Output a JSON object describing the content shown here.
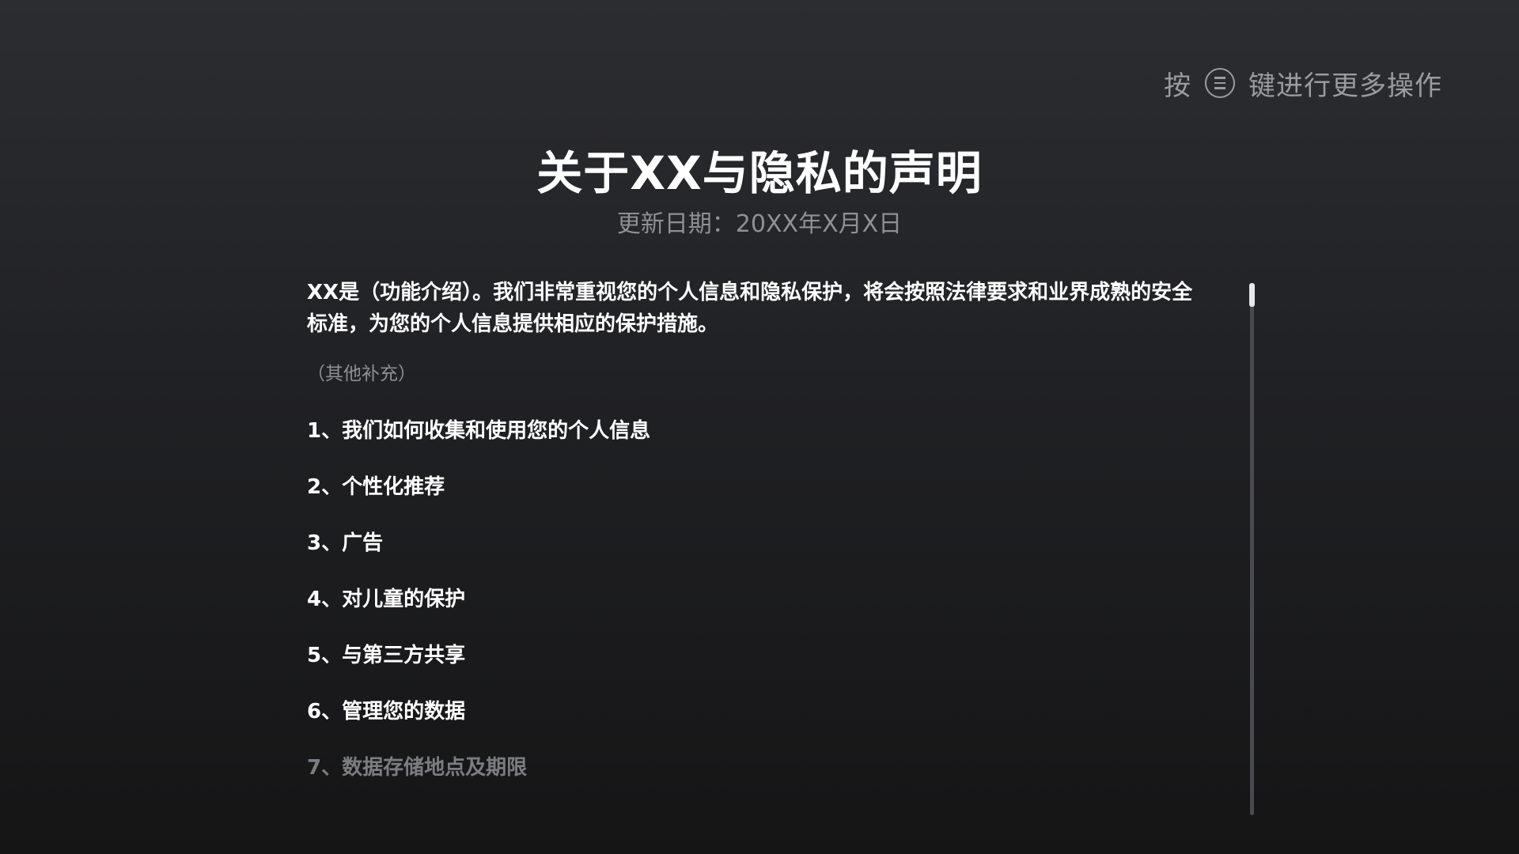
{
  "hint": {
    "prefix": "按",
    "icon": "menu-icon",
    "suffix": "键进行更多操作"
  },
  "title": "关于XX与隐私的声明",
  "update_date": "更新日期：20XX年X月X日",
  "intro": "XX是（功能介绍）。我们非常重视您的个人信息和隐私保护，将会按照法律要求和业界成熟的安全标准，为您的个人信息提供相应的保护措施。",
  "supplement": "（其他补充）",
  "sections": [
    "1、我们如何收集和使用您的个人信息",
    "2、个性化推荐",
    "3、广告",
    "4、对儿童的保护",
    "5、与第三方共享",
    "6、管理您的数据",
    "7、数据存储地点及期限"
  ],
  "scroll": {
    "position_fraction": 0.0
  },
  "colors": {
    "text_primary": "#ffffff",
    "text_secondary": "#8f9095",
    "text_faded": "#7c7d82",
    "scroll_track": "#4a4b4f",
    "scroll_thumb": "#e8e8ea"
  }
}
